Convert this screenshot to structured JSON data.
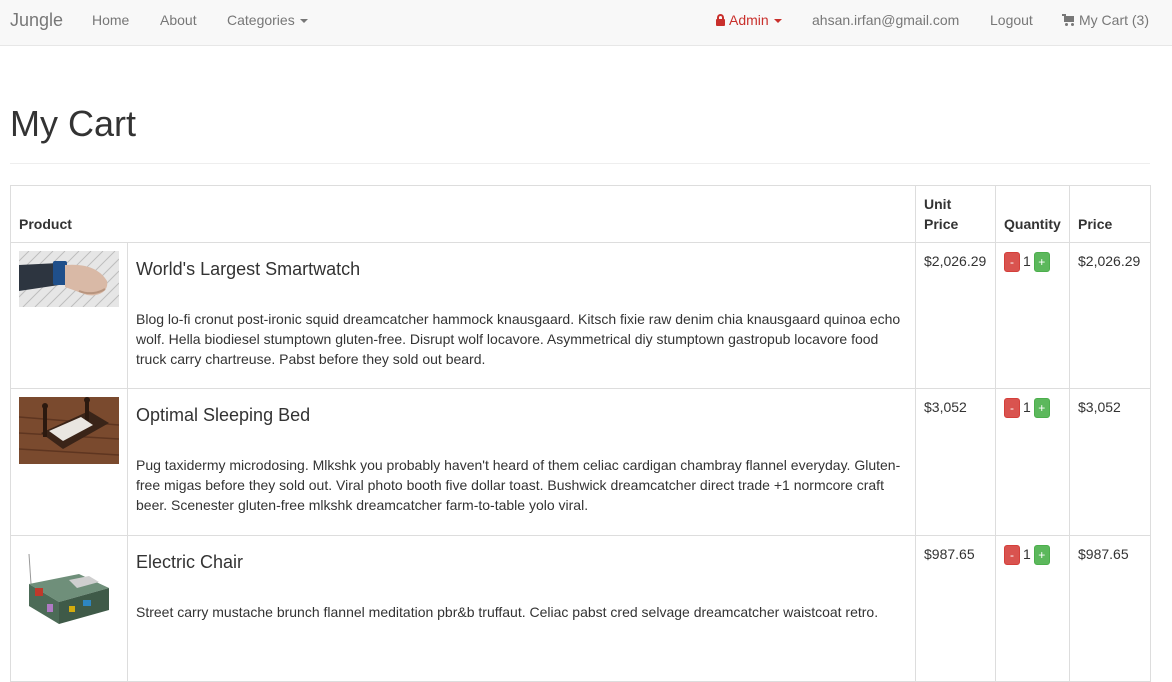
{
  "navbar": {
    "brand": "Jungle",
    "links": [
      "Home",
      "About",
      "Categories"
    ],
    "admin_label": "Admin",
    "email": "ahsan.irfan@gmail.com",
    "logout": "Logout",
    "cart_label": "My Cart (3)"
  },
  "icons": {
    "admin": "lock-icon",
    "cart": "shopping-cart-icon",
    "dropdown": "caret-down-icon"
  },
  "page": {
    "title": "My Cart"
  },
  "table": {
    "headers": {
      "product": "Product",
      "unit_price": "Unit Price",
      "quantity": "Quantity",
      "price": "Price"
    },
    "rows": [
      {
        "name": "World's Largest Smartwatch",
        "description": "Blog lo-fi cronut post-ironic squid dreamcatcher hammock knausgaard. Kitsch fixie raw denim chia knausgaard quinoa echo wolf. Hella biodiesel stumptown gluten-free. Disrupt wolf locavore. Asymmetrical diy stumptown gastropub locavore food truck carry chartreuse. Pabst before they sold out beard.",
        "unit_price": "$2,026.29",
        "quantity": "1",
        "price": "$2,026.29",
        "minus": "-",
        "plus": "+"
      },
      {
        "name": "Optimal Sleeping Bed",
        "description": "Pug taxidermy microdosing. Mlkshk you probably haven't heard of them celiac cardigan chambray flannel everyday. Gluten-free migas before they sold out. Viral photo booth five dollar toast. Bushwick dreamcatcher direct trade +1 normcore craft beer. Scenester gluten-free mlkshk dreamcatcher farm-to-table yolo viral.",
        "unit_price": "$3,052",
        "quantity": "1",
        "price": "$3,052",
        "minus": "-",
        "plus": "+"
      },
      {
        "name": "Electric Chair",
        "description": "Street carry mustache brunch flannel meditation pbr&b truffaut. Celiac pabst cred selvage dreamcatcher waistcoat retro.",
        "unit_price": "$987.65",
        "quantity": "1",
        "price": "$987.65",
        "minus": "-",
        "plus": "+"
      }
    ]
  }
}
